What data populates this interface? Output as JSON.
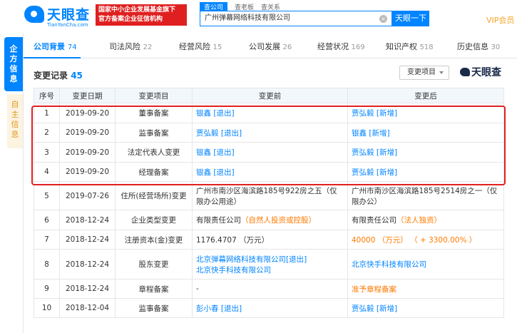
{
  "header": {
    "logo_text": "天眼查",
    "logo_sub": "TianYanCha.com",
    "badge_line1": "国家中小企业发展基金旗下",
    "badge_line2": "官方备案企业征信机构",
    "search_tabs": [
      "查公司",
      "查老板",
      "查关系"
    ],
    "search_value": "广州弹幕网络科技有限公司",
    "search_button": "天眼一下",
    "vip": "VIP会员"
  },
  "side": {
    "tab1": [
      "企",
      "业",
      "信",
      "息"
    ],
    "tab1_text": "企方信息",
    "tab2_text": "自主信息"
  },
  "nav": {
    "items": [
      {
        "label": "公司背景",
        "count": "74"
      },
      {
        "label": "司法风险",
        "count": "22"
      },
      {
        "label": "经营风险",
        "count": "15"
      },
      {
        "label": "公司发展",
        "count": "26"
      },
      {
        "label": "经营状况",
        "count": "169"
      },
      {
        "label": "知识产权",
        "count": "518"
      },
      {
        "label": "历史信息",
        "count": "30"
      }
    ]
  },
  "section": {
    "title": "变更记录",
    "count": "45",
    "dropdown": "变更项目",
    "watermark": "天眼查"
  },
  "table": {
    "headers": [
      "序号",
      "变更日期",
      "变更项目",
      "变更前",
      "变更后"
    ],
    "rows": [
      {
        "no": "1",
        "date": "2019-09-20",
        "item": "董事备案",
        "before_a": "银鑫",
        "before_b": "[退出]",
        "before_c": "",
        "after_a": "贾弘毅",
        "after_b": "[新增]"
      },
      {
        "no": "2",
        "date": "2019-09-20",
        "item": "监事备案",
        "before_a": "贾弘毅",
        "before_b": "[退出]",
        "before_c": "",
        "after_a": "银鑫",
        "after_b": "[新增]"
      },
      {
        "no": "3",
        "date": "2019-09-20",
        "item": "法定代表人变更",
        "before_a": "银鑫",
        "before_b": "[退出]",
        "before_c": "",
        "after_a": "贾弘毅",
        "after_b": "[新增]"
      },
      {
        "no": "4",
        "date": "2019-09-20",
        "item": "经理备案",
        "before_a": "银鑫",
        "before_b": "[退出]",
        "before_c": "",
        "after_a": "贾弘毅",
        "after_b": "[新增]"
      },
      {
        "no": "5",
        "date": "2019-07-26",
        "item": "住所(经营场所)变更",
        "before_a": "广州市南沙区海滨路185号922房之五（仅限办公用途）",
        "before_b": "",
        "before_c": "",
        "after_a": "广州市南沙区海滨路185号2514房之一（仅限办公）",
        "after_b": ""
      },
      {
        "no": "6",
        "date": "2018-12-24",
        "item": "企业类型变更",
        "before_a": "有限责任公司",
        "before_b": "（自然人投资或控股）",
        "before_c": "",
        "after_a": "有限责任公司",
        "after_b": "（法人独资）"
      },
      {
        "no": "7",
        "date": "2018-12-24",
        "item": "注册资本(金)变更",
        "before_a": "1176.4707 （万元）",
        "before_b": "",
        "before_c": "",
        "after_a": "40000 （万元）",
        "after_b": "（ + 3300.00% ）"
      },
      {
        "no": "8",
        "date": "2018-12-24",
        "item": "股东变更",
        "before_a": "北京弹幕网络科技有限公司",
        "before_b": "[退出]",
        "before_c": "北京快手科技有限公司",
        "after_a": "北京快手科技有限公司",
        "after_b": ""
      },
      {
        "no": "9",
        "date": "2018-12-24",
        "item": "章程备案",
        "before_a": "-",
        "before_b": "",
        "before_c": "",
        "after_a": "准予章程备案",
        "after_b": ""
      },
      {
        "no": "10",
        "date": "2018-12-04",
        "item": "监事备案",
        "before_a": "彭小春",
        "before_b": "[退出]",
        "before_c": "",
        "after_a": "贾弘毅",
        "after_b": "[新增]"
      }
    ]
  },
  "colors": {
    "accent": "#0084ff",
    "highlight": "#e02020",
    "orange": "#ff7a00"
  }
}
